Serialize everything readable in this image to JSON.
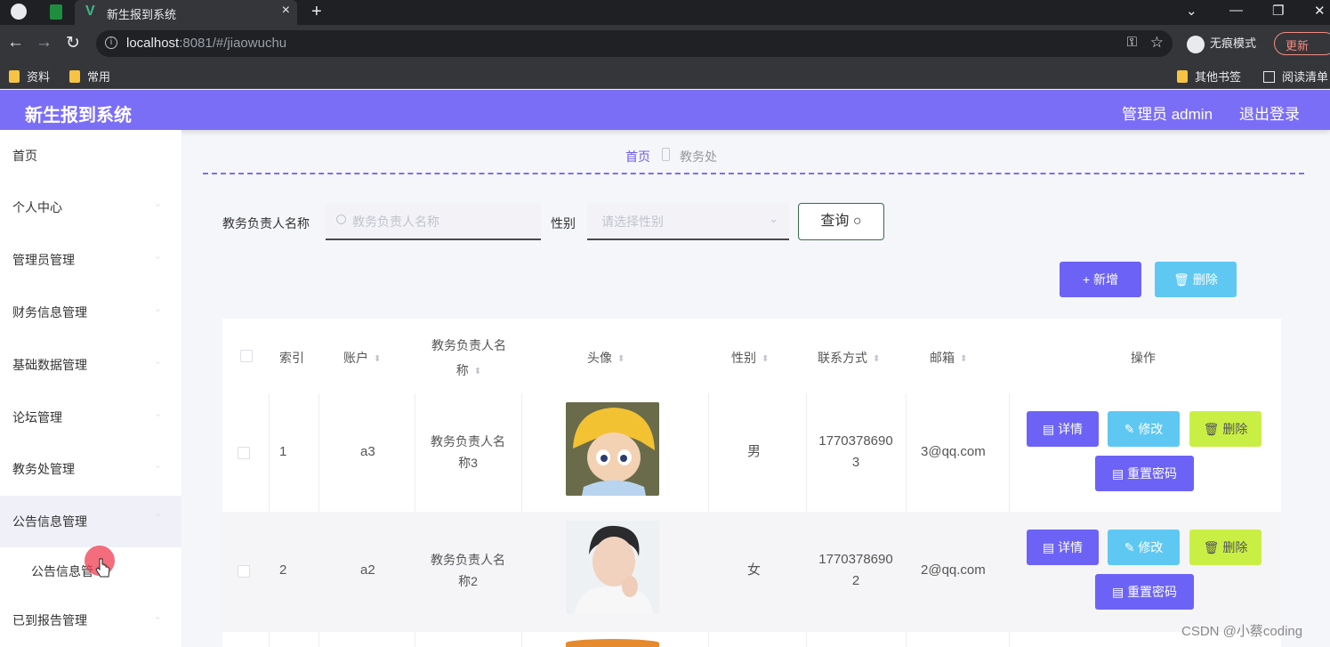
{
  "browser": {
    "tab_title": "新生报到系统",
    "url_host": "localhost",
    "url_path": ":8081/#/jiaowuchu",
    "incognito_label": "无痕模式",
    "update_label": "更新",
    "bookmarks": [
      "资料",
      "常用"
    ],
    "bookmarks_right": [
      "其他书签",
      "阅读清单"
    ]
  },
  "header": {
    "title": "新生报到系统",
    "admin_label": "管理员 admin",
    "logout_label": "退出登录"
  },
  "sidebar": {
    "items": [
      {
        "label": "首页"
      },
      {
        "label": "个人中心"
      },
      {
        "label": "管理员管理"
      },
      {
        "label": "财务信息管理"
      },
      {
        "label": "基础数据管理"
      },
      {
        "label": "论坛管理"
      },
      {
        "label": "教务处管理"
      },
      {
        "label": "公告信息管理"
      }
    ],
    "submenu_label": "公告信息管",
    "last_item": "已到报告管理"
  },
  "breadcrumb": {
    "home": "首页",
    "current": "教务处"
  },
  "search": {
    "name_label": "教务负责人名称",
    "name_placeholder": "教务负责人名称",
    "gender_label": "性别",
    "gender_placeholder": "请选择性别",
    "query_label": "查询"
  },
  "toolbar": {
    "add_label": "+ 新增",
    "delete_label": "删除"
  },
  "table": {
    "headers": {
      "index": "索引",
      "account": "账户",
      "name_line1": "教务负责人名",
      "name_line2": "称",
      "avatar": "头像",
      "gender": "性别",
      "contact": "联系方式",
      "email": "邮箱",
      "ops": "操作"
    },
    "rows": [
      {
        "index": "1",
        "account": "a3",
        "name_line1": "教务负责人名",
        "name_line2": "称3",
        "gender": "男",
        "phone_line1": "1770378690",
        "phone_line2": "3",
        "email": "3@qq.com"
      },
      {
        "index": "2",
        "account": "a2",
        "name_line1": "教务负责人名",
        "name_line2": "称2",
        "gender": "女",
        "phone_line1": "1770378690",
        "phone_line2": "2",
        "email": "2@qq.com"
      }
    ],
    "actions": {
      "detail": "详情",
      "edit": "修改",
      "delete": "删除",
      "reset": "重置密码"
    }
  },
  "watermark": "CSDN @小蔡coding",
  "colors": {
    "brand": "#7b6ef6",
    "primary_button": "#6c63f6",
    "info_button": "#5ec8f3",
    "lime_button": "#c9ef45"
  }
}
